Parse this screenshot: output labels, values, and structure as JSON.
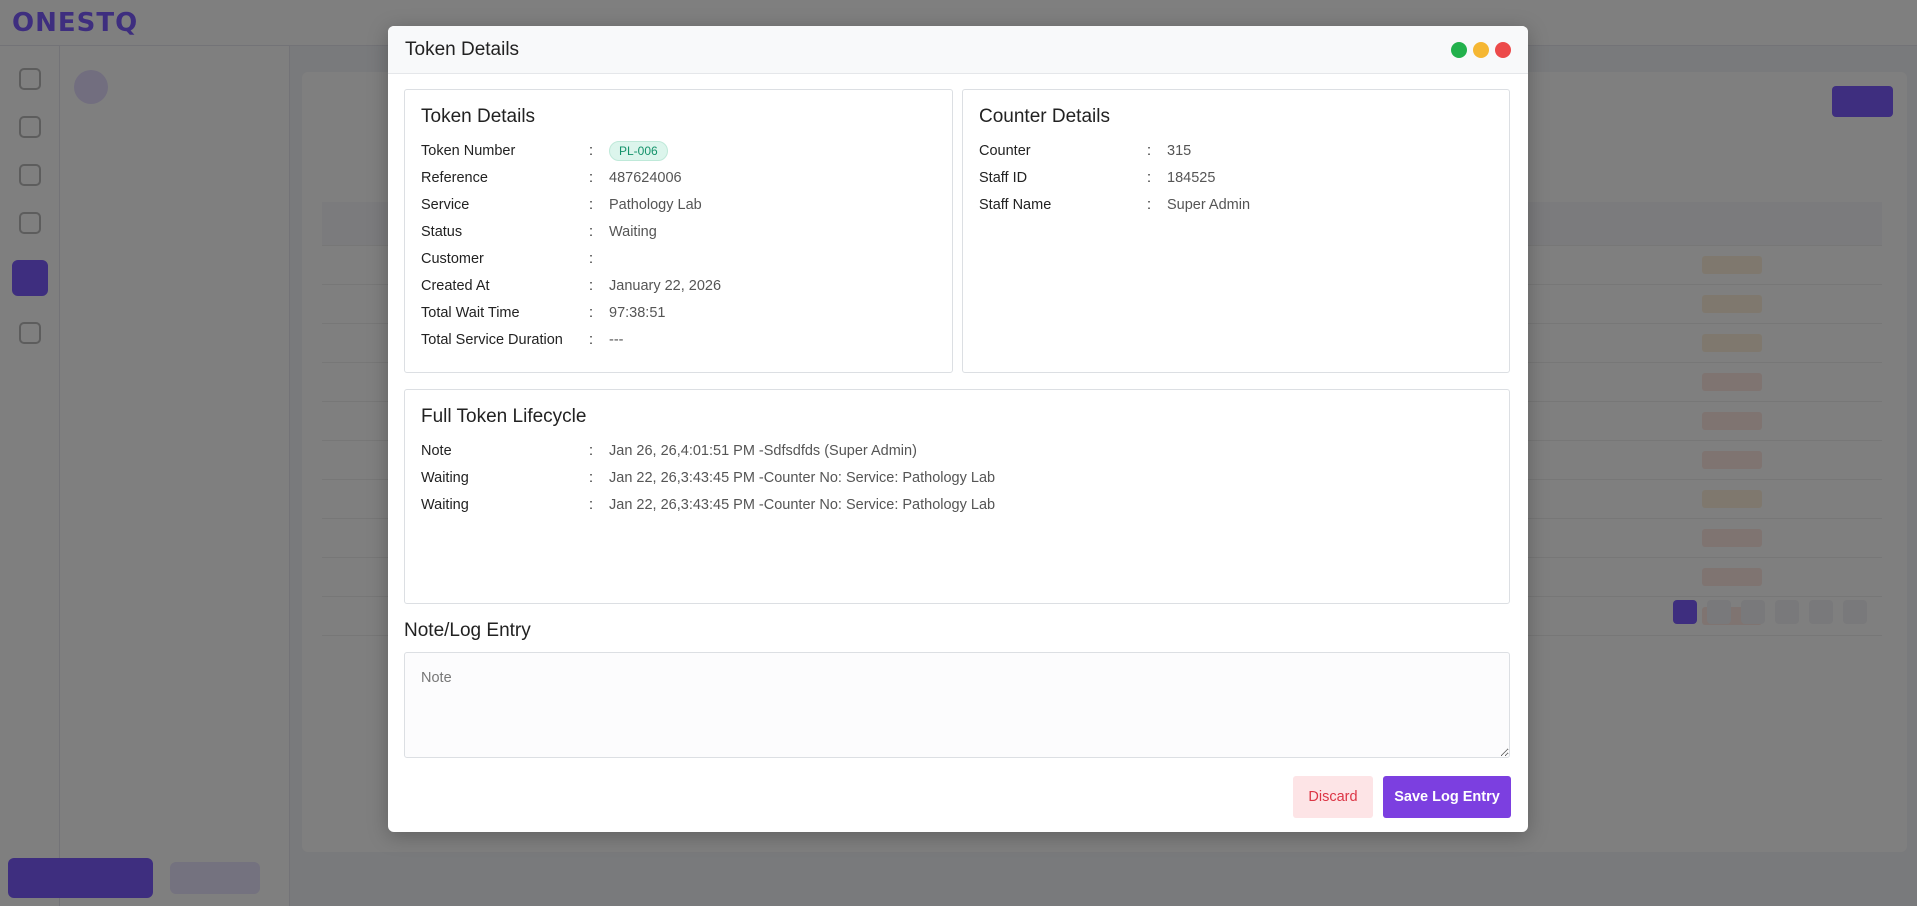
{
  "modal": {
    "title": "Token Details",
    "window_controls": [
      "green-dot",
      "yellow-dot",
      "red-close-dot"
    ]
  },
  "token_details": {
    "title": "Token Details",
    "rows": [
      {
        "label": "Token Number",
        "value": "PL-006",
        "badge": true
      },
      {
        "label": "Reference",
        "value": "487624006"
      },
      {
        "label": "Service",
        "value": "Pathology Lab"
      },
      {
        "label": "Status",
        "value": "Waiting"
      },
      {
        "label": "Customer",
        "value": ""
      },
      {
        "label": "Created At",
        "value": "January 22, 2026"
      },
      {
        "label": "Total Wait Time",
        "value": "97:38:51"
      },
      {
        "label": "Total Service Duration",
        "value": "---"
      }
    ]
  },
  "counter_details": {
    "title": "Counter Details",
    "rows": [
      {
        "label": "Counter",
        "value": "315"
      },
      {
        "label": "Staff ID",
        "value": "184525"
      },
      {
        "label": "Staff Name",
        "value": "Super Admin"
      }
    ]
  },
  "lifecycle": {
    "title": "Full Token Lifecycle",
    "rows": [
      {
        "label": "Note",
        "value": "Jan 26, 26,4:01:51 PM -Sdfsdfds (Super Admin)"
      },
      {
        "label": "Waiting",
        "value": "Jan 22, 26,3:43:45 PM -Counter No: Service: Pathology Lab"
      },
      {
        "label": "Waiting",
        "value": "Jan 22, 26,3:43:45 PM -Counter No: Service: Pathology Lab"
      }
    ]
  },
  "log_entry": {
    "title": "Note/Log Entry",
    "placeholder": "Note",
    "value": ""
  },
  "buttons": {
    "discard": "Discard",
    "save": "Save Log Entry"
  },
  "colors": {
    "accent": "#7c3fe0",
    "badge_bg": "#dcf5ec",
    "badge_text": "#14926a",
    "discard_bg": "#fde4e6",
    "discard_text": "#dc3545"
  }
}
